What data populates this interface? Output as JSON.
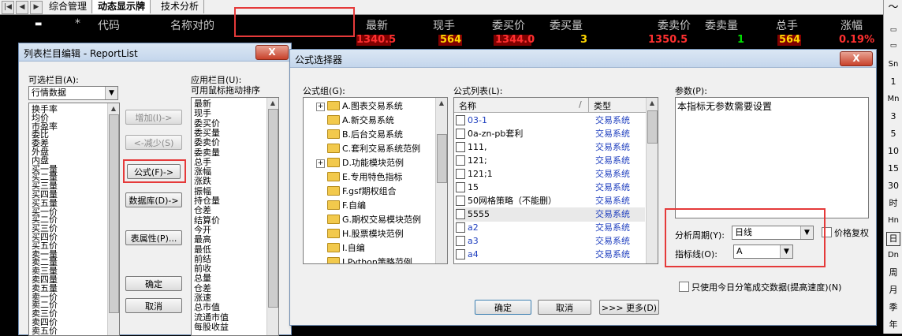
{
  "tabs": [
    "综合管理",
    "动态显示牌",
    "技术分析"
  ],
  "quote": {
    "headers": [
      "*",
      "代码",
      "名称对的",
      "最新",
      "现手",
      "委买价",
      "委买量",
      "委卖价",
      "委卖量",
      "总手",
      "涨幅"
    ],
    "row": [
      "1340.5",
      "564",
      "1344.0",
      "3",
      "1350.5",
      "1",
      "564",
      "0.19%"
    ]
  },
  "right_toolbar": [
    "1",
    "Mn",
    "3",
    "5",
    "10",
    "15",
    "30",
    "时",
    "Hn",
    "日",
    "Dn",
    "周",
    "月",
    "季",
    "年"
  ],
  "report_dialog": {
    "title": "列表栏目编辑 - ReportList",
    "close": "X",
    "available_label": "可选栏目(A):",
    "category": "行情数据",
    "available_items": [
      "换手率",
      "均价",
      "市盈率",
      "委比",
      "委差",
      "外盘",
      "内盘",
      "买一量",
      "买二量",
      "买三量",
      "买四量",
      "买五量",
      "买一价",
      "买二价",
      "买三价",
      "买四价",
      "买五价",
      "卖一量",
      "卖二量",
      "卖三量",
      "卖四量",
      "卖五量",
      "卖一价",
      "卖二价",
      "卖三价",
      "卖四价",
      "卖五价"
    ],
    "applied_label": "应用栏目(U):",
    "applied_hint": "可用鼠标拖动排序",
    "applied_items": [
      "最新",
      "现手",
      "委买价",
      "委买量",
      "委卖价",
      "委卖量",
      "总手",
      "涨幅",
      "涨跌",
      "振幅",
      "持仓量",
      "仓差",
      "结算价",
      "今开",
      "最高",
      "最低",
      "前结",
      "前收",
      "总量",
      "仓差",
      "涨速",
      "总市值",
      "流通市值",
      "每股收益"
    ],
    "buttons": {
      "add": "增加(I)->",
      "remove": "<-减少(S)",
      "formula": "公式(F)->",
      "database": "数据库(D)->",
      "attr": "表属性(P)...",
      "ok": "确定",
      "cancel": "取消"
    }
  },
  "formula_dialog": {
    "title": "公式选择器",
    "close": "X",
    "group_label": "公式组(G):",
    "groups": [
      "A.图表交易系统",
      "A.新交易系统",
      "B.后台交易系统",
      "C.套利交易系统范例",
      "D.功能模块范例",
      "E.专用特色指标",
      "F.gsf期权组合",
      "F.自编",
      "G.期权交易模块范例",
      "H.股票模块范例",
      "I.自编",
      "I.Python策略范例"
    ],
    "list_label": "公式列表(L):",
    "col_name": "名称",
    "col_sort": "/",
    "col_type": "类型",
    "formulas": [
      {
        "name": "03-1",
        "type": "交易系统",
        "blue": true
      },
      {
        "name": "0a-zn-pb套利",
        "type": "交易系统",
        "blue": false
      },
      {
        "name": "111,",
        "type": "交易系统",
        "blue": false
      },
      {
        "name": "121;",
        "type": "交易系统",
        "blue": false
      },
      {
        "name": "121;1",
        "type": "交易系统",
        "blue": false
      },
      {
        "name": "15",
        "type": "交易系统",
        "blue": false
      },
      {
        "name": "50网格策略（不能删）",
        "type": "交易系统",
        "blue": false
      },
      {
        "name": "5555",
        "type": "交易系统",
        "blue": false
      },
      {
        "name": "a2",
        "type": "交易系统",
        "blue": true
      },
      {
        "name": "a3",
        "type": "交易系统",
        "blue": true
      },
      {
        "name": "a4",
        "type": "交易系统",
        "blue": true
      }
    ],
    "params_label": "参数(P):",
    "params_text": "本指标无参数需要设置",
    "period_label": "分析周期(Y):",
    "period_value": "日线",
    "restore_label": "价格复权",
    "indicator_label": "指标线(O):",
    "indicator_value": "A",
    "only_today_label": "只使用今日分笔成交数据(提高速度)(N)",
    "ok": "确定",
    "cancel": "取消",
    "more": ">>> 更多(D)"
  },
  "colors": {
    "highlight": "#e53a3a",
    "price_red": "#ff3030",
    "price_yellow": "#ffd700",
    "price_green": "#00e000",
    "title_bar": "#c4d6ec",
    "blue_text": "#1f3fbf"
  }
}
